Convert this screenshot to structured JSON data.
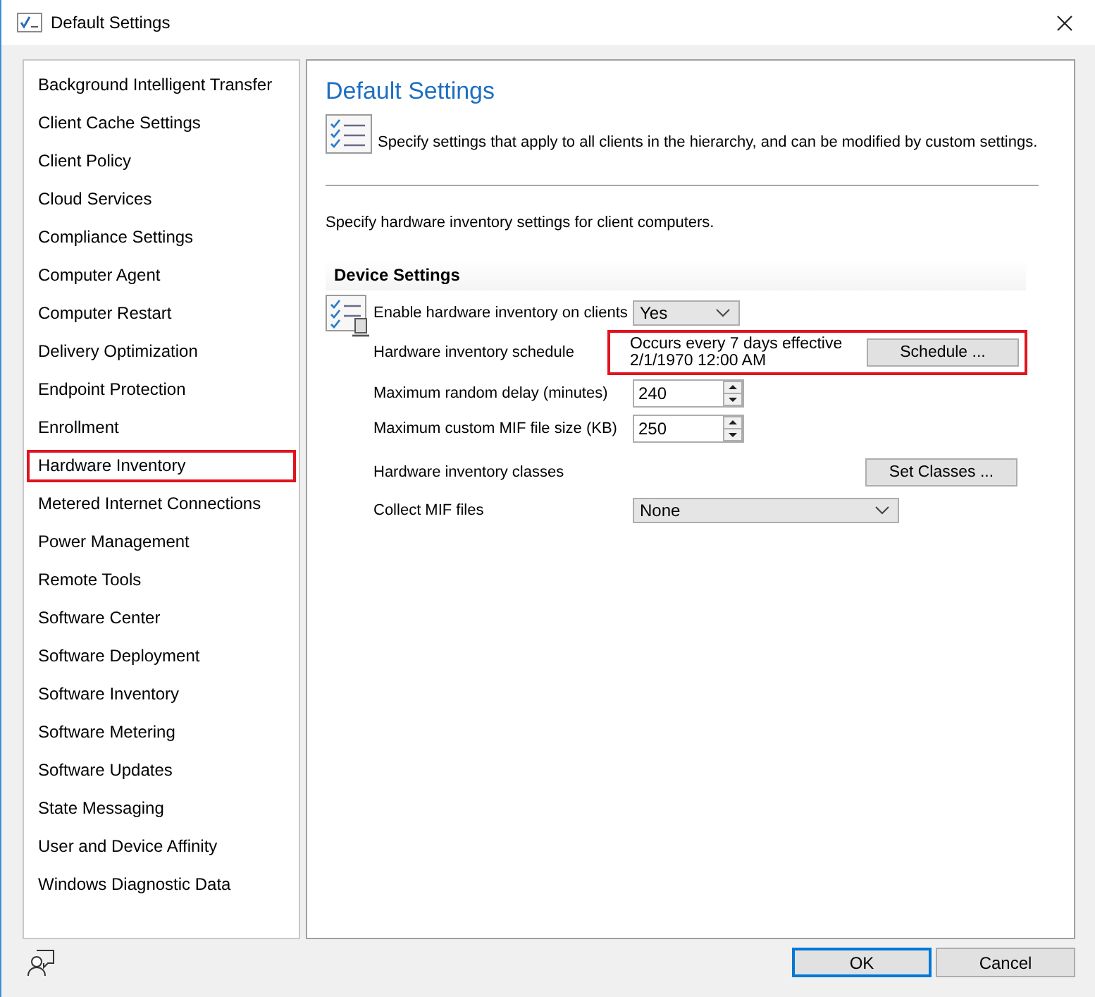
{
  "window": {
    "title": "Default Settings"
  },
  "sidebar": {
    "items": [
      {
        "label": "Background Intelligent Transfer",
        "selected": false
      },
      {
        "label": "Client Cache Settings",
        "selected": false
      },
      {
        "label": "Client Policy",
        "selected": false
      },
      {
        "label": "Cloud Services",
        "selected": false
      },
      {
        "label": "Compliance Settings",
        "selected": false
      },
      {
        "label": "Computer Agent",
        "selected": false
      },
      {
        "label": "Computer Restart",
        "selected": false
      },
      {
        "label": "Delivery Optimization",
        "selected": false
      },
      {
        "label": "Endpoint Protection",
        "selected": false
      },
      {
        "label": "Enrollment",
        "selected": false
      },
      {
        "label": "Hardware Inventory",
        "selected": true
      },
      {
        "label": "Metered Internet Connections",
        "selected": false
      },
      {
        "label": "Power Management",
        "selected": false
      },
      {
        "label": "Remote Tools",
        "selected": false
      },
      {
        "label": "Software Center",
        "selected": false
      },
      {
        "label": "Software Deployment",
        "selected": false
      },
      {
        "label": "Software Inventory",
        "selected": false
      },
      {
        "label": "Software Metering",
        "selected": false
      },
      {
        "label": "Software Updates",
        "selected": false
      },
      {
        "label": "State Messaging",
        "selected": false
      },
      {
        "label": "User and Device Affinity",
        "selected": false
      },
      {
        "label": "Windows Diagnostic Data",
        "selected": false
      }
    ]
  },
  "panel": {
    "title": "Default Settings",
    "intro": "Specify settings that apply to all clients in the hierarchy, and can be modified by custom settings.",
    "description": "Specify hardware inventory settings for client computers.",
    "section": "Device Settings",
    "settings": [
      {
        "kind": "dropdown",
        "label": "Enable hardware inventory on clients",
        "value": "Yes"
      },
      {
        "kind": "schedule",
        "label": "Hardware inventory schedule",
        "lines": [
          "Occurs every 7 days effective",
          "2/1/1970 12:00 AM"
        ],
        "button": "Schedule ...",
        "highlighted": true
      },
      {
        "kind": "spinner",
        "label": "Maximum random delay (minutes)",
        "value": "240"
      },
      {
        "kind": "spinner",
        "label": "Maximum custom MIF file size (KB)",
        "value": "250"
      },
      {
        "kind": "button",
        "label": "Hardware inventory classes",
        "button": "Set Classes ..."
      },
      {
        "kind": "wide-dropdown",
        "label": "Collect MIF files",
        "value": "None"
      }
    ]
  },
  "buttons": [
    {
      "label": "OK",
      "default": true
    },
    {
      "label": "Cancel",
      "default": false
    }
  ]
}
